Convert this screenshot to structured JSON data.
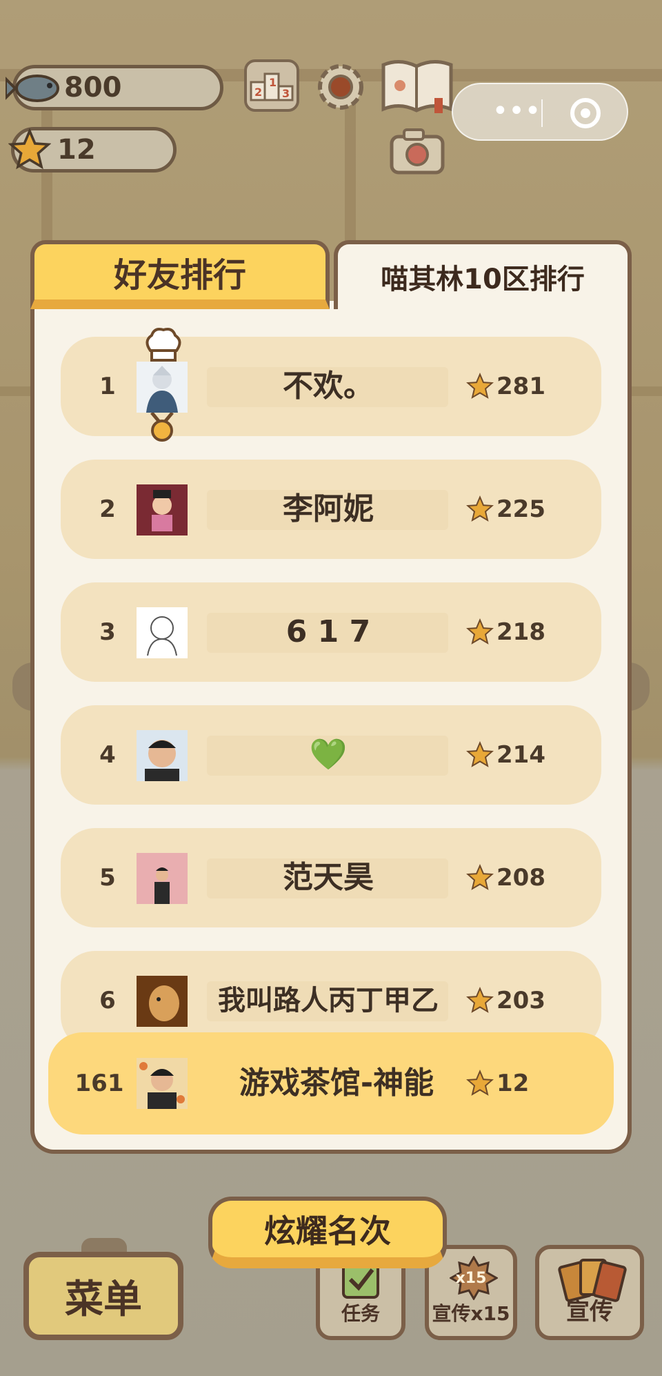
{
  "hud": {
    "fish_count": "800",
    "star_count": "12",
    "leaderboard_icon_text": "213"
  },
  "tabs": {
    "friends": "好友排行",
    "server": "喵其林10区排行"
  },
  "ranking": [
    {
      "rank": "1",
      "name": "不欢。",
      "score": "281"
    },
    {
      "rank": "2",
      "name": "李阿妮",
      "score": "225"
    },
    {
      "rank": "3",
      "name": "6 1 7",
      "score": "218"
    },
    {
      "rank": "4",
      "name": "💚",
      "score": "214"
    },
    {
      "rank": "5",
      "name": "范天昊",
      "score": "208"
    },
    {
      "rank": "6",
      "name": "我叫路人丙丁甲乙",
      "score": "203"
    }
  ],
  "me": {
    "rank": "161",
    "name": "游戏茶馆-神能",
    "score": "12"
  },
  "bottom": {
    "show_off": "炫耀名次",
    "menu": "菜单",
    "task": "任务",
    "promote_x15": "宣传x15",
    "promote_badge": "x15",
    "promote": "宣传"
  },
  "colors": {
    "tab_active": "#fcd35e",
    "row_bg": "#f3e2bf",
    "my_row_bg": "#fdd87c",
    "border": "#7b5f48",
    "star": "#e8a838"
  }
}
